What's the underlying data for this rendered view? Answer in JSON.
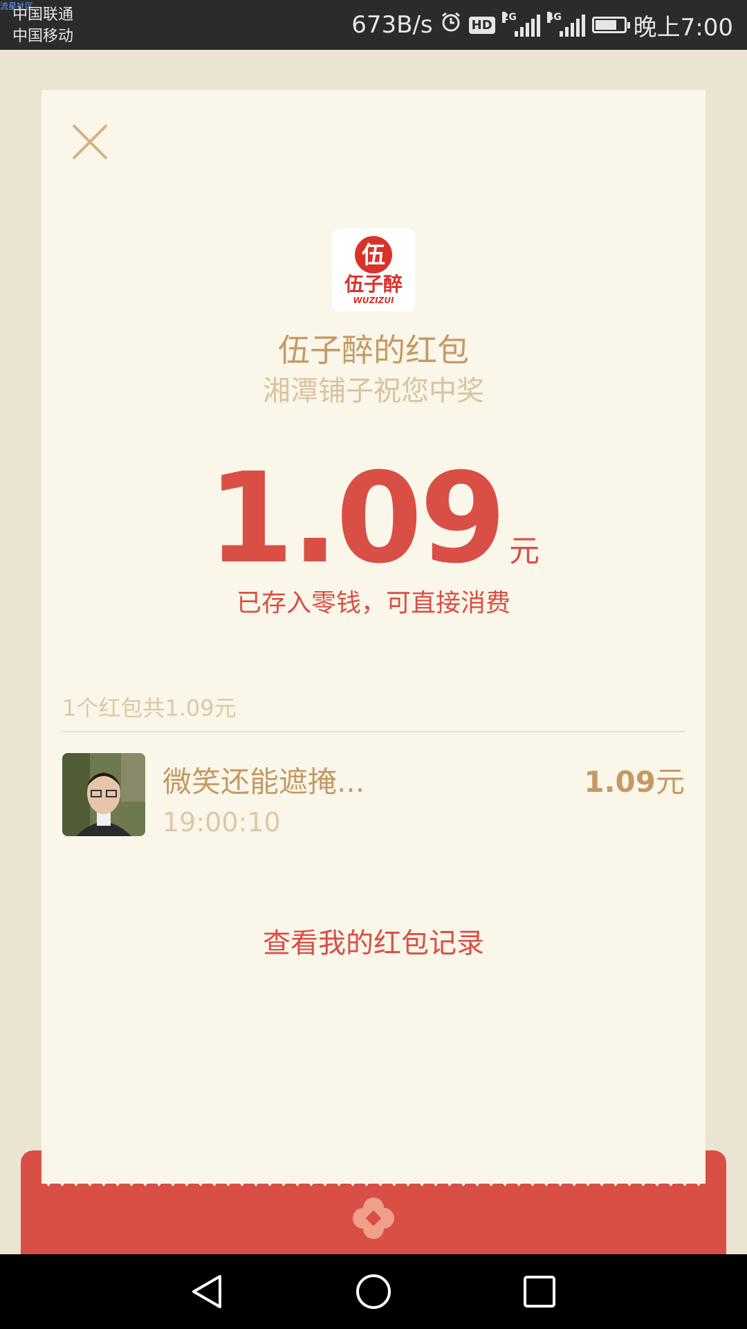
{
  "status_bar": {
    "watermark": "流星社区",
    "carrier1": "中国联通",
    "carrier2": "中国移动",
    "net_speed": "673B/s",
    "hd_label": "HD",
    "signal1_label": "2G",
    "signal2_label": "4G",
    "time": "晚上7:00",
    "battery_level": 0.75
  },
  "card": {
    "close_icon": "close-icon",
    "logo_text": "伍子醉",
    "logo_sub": "WUZIZUI",
    "sender_title": "伍子醉的红包",
    "wish": "湘潭铺子祝您中奖",
    "amount": "1.09",
    "amount_unit": "元",
    "saved_note": "已存入零钱，可直接消费",
    "summary": "1个红包共1.09元",
    "record": {
      "name": "微笑还能遮掩...",
      "time": "19:00:10",
      "amount": "1.09",
      "amount_unit": "元"
    },
    "history_link": "查看我的红包记录"
  },
  "colors": {
    "accent_red": "#d94f45",
    "gold": "#c49a63",
    "light_gold": "#dcc8a6",
    "card_bg": "#fbf6ea",
    "page_bg": "#ece4d3"
  }
}
